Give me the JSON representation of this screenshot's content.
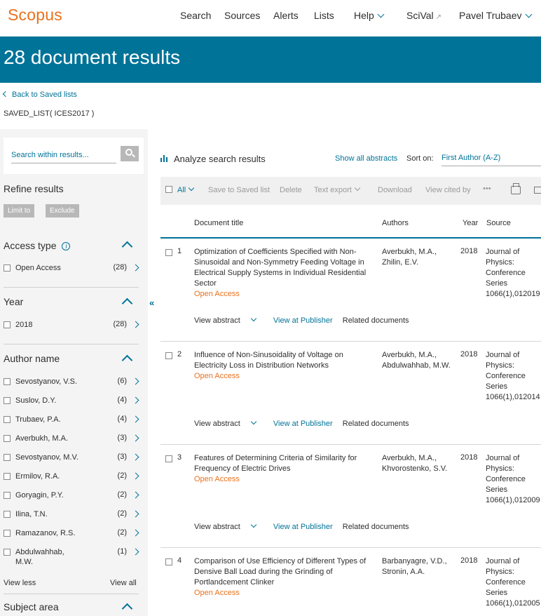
{
  "nav": {
    "logo": "Scopus",
    "search": "Search",
    "sources": "Sources",
    "alerts": "Alerts",
    "lists": "Lists",
    "help": "Help",
    "scival": "SciVal",
    "user": "Pavel Trubaev"
  },
  "banner": {
    "title": "28 document results"
  },
  "back_link": "Back to Saved lists",
  "saved_list": "SAVED_LIST( ICES2017 )",
  "sidebar": {
    "search_placeholder": "Search within results...",
    "refine_title": "Refine results",
    "limit_to": "Limit to",
    "exclude": "Exclude",
    "facets": {
      "access_type": {
        "title": "Access type",
        "items": [
          {
            "label": "Open Access",
            "count": "(28)"
          }
        ]
      },
      "year": {
        "title": "Year",
        "items": [
          {
            "label": "2018",
            "count": "(28)"
          }
        ]
      },
      "author_name": {
        "title": "Author name",
        "items": [
          {
            "label": "Sevostyanov, V.S.",
            "count": "(6)"
          },
          {
            "label": "Suslov, D.Y.",
            "count": "(4)"
          },
          {
            "label": "Trubaev, P.A.",
            "count": "(4)"
          },
          {
            "label": "Averbukh, M.A.",
            "count": "(3)"
          },
          {
            "label": "Sevostyanov, M.V.",
            "count": "(3)"
          },
          {
            "label": "Ermilov, R.A.",
            "count": "(2)"
          },
          {
            "label": "Goryagin, P.Y.",
            "count": "(2)"
          },
          {
            "label": "Ilina, T.N.",
            "count": "(2)"
          },
          {
            "label": "Ramazanov, R.S.",
            "count": "(2)"
          },
          {
            "label": "Abdulwahhab, M.W.",
            "count": "(1)"
          }
        ]
      },
      "subject_area": {
        "title": "Subject area"
      }
    },
    "view_less": "View less",
    "view_all": "View all"
  },
  "main": {
    "analyze": "Analyze search results",
    "show_abstracts": "Show all abstracts",
    "sort_label": "Sort on:",
    "sort_value": "First Author (A-Z)",
    "toolbar": {
      "all": "All",
      "save": "Save to Saved list",
      "delete": "Delete",
      "text_export": "Text export",
      "download": "Download",
      "view_cited_by": "View cited by",
      "more": "•••"
    },
    "columns": {
      "title": "Document title",
      "authors": "Authors",
      "year": "Year",
      "source": "Source"
    },
    "link_labels": {
      "view_abstract": "View abstract",
      "view_publisher": "View at Publisher",
      "related": "Related documents"
    },
    "results": [
      {
        "num": "1",
        "title": "Optimization of Coefficients Specified with Non-Sinusoidal and Non-Symmetry Feeding Voltage in Electrical Supply Systems in Individual Residential Sector",
        "access": "Open Access",
        "authors": "Averbukh, M.A., Zhilin, E.V.",
        "year": "2018",
        "source": "Journal of Physics: Conference Series 1066(1),012019"
      },
      {
        "num": "2",
        "title": "Influence of Non-Sinusoidality of Voltage on Electricity Loss in Distribution Networks",
        "access": "Open Access",
        "authors": "Averbukh, M.A., Abdulwahhab, M.W.",
        "year": "2018",
        "source": "Journal of Physics: Conference Series 1066(1),012014"
      },
      {
        "num": "3",
        "title": "Features of Determining Criteria of Similarity for Frequency of Electric Drives",
        "access": "Open Access",
        "authors": "Averbukh, M.A., Khvorostenko, S.V.",
        "year": "2018",
        "source": "Journal of Physics: Conference Series 1066(1),012009"
      },
      {
        "num": "4",
        "title": "Comparison of Use Efficiency of Different Types of Densive Ball Load during the Grinding of Portlandcement Clinker",
        "access": "Open Access",
        "authors": "Barbanyagre, V.D., Stronin, A.A.",
        "year": "2018",
        "source": "Journal of Physics: Conference Series 1066(1),012005"
      }
    ]
  }
}
